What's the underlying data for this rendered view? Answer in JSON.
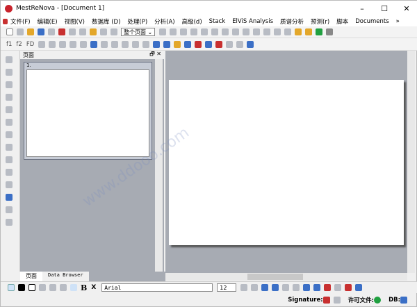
{
  "window": {
    "title": "MestReNova - [Document 1]",
    "minimize": "–",
    "maximize": "☐",
    "close": "✕"
  },
  "menu": [
    "文件(F)",
    "编辑(E)",
    "视图(V)",
    "数据库 (D)",
    "处理(P)",
    "分析(A)",
    "高级(d)",
    "Stack",
    "ElViS Analysis",
    "质谱分析",
    "预测(r)",
    "脚本",
    "Documents",
    "»"
  ],
  "toolbar1": {
    "zoom_select": "整个页面"
  },
  "toolbar2": {
    "f1": "f1",
    "f2": "f2",
    "fd": "FD"
  },
  "pages_panel": {
    "title": "页面",
    "thumbnail_label": "1.",
    "float": "🗗",
    "close": "✕"
  },
  "tabs": [
    "页面",
    "Data Browser"
  ],
  "format_toolbar": {
    "font": "Arial",
    "size": "12",
    "bold": "B",
    "subscript": "X"
  },
  "status": {
    "signature": "Signature:",
    "license": "许可文件:",
    "db": "DB:"
  },
  "watermark": "www.ddooo.com"
}
